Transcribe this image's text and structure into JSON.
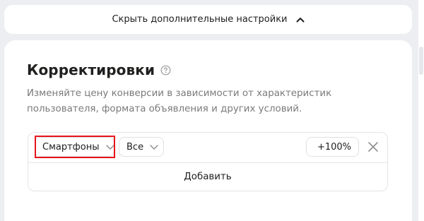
{
  "toggle": {
    "label": "Скрыть дополнительные настройки",
    "icon": "chevron-up-icon"
  },
  "adjustments": {
    "title": "Корректировки",
    "help_icon": "question-circle-icon",
    "description": "Изменяйте цену конверсии в зависимости от характеристик пользователя, формата объявления и других условий.",
    "row": {
      "device_value": "Смартфоны",
      "os_value": "Все",
      "percent_value": "+100%",
      "remove_icon": "close-icon"
    },
    "add_label": "Добавить",
    "highlight_color": "#e8141b"
  }
}
